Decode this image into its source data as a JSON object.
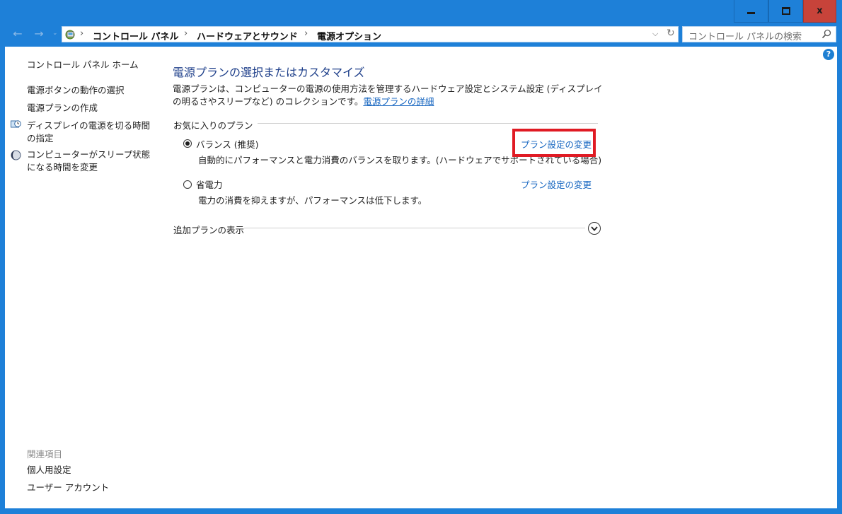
{
  "window": {
    "minimize_glyph": "minimize-icon",
    "maximize_glyph": "maximize-icon",
    "close_glyph": "x"
  },
  "nav": {
    "back_glyph": "←",
    "forward_glyph": "→",
    "recent_glyph": "⌄",
    "breadcrumb": [
      "コントロール パネル",
      "ハードウェアとサウンド",
      "電源オプション"
    ],
    "separator": "›",
    "dropdown_glyph": "⌵",
    "refresh_glyph": "↻",
    "search_placeholder": "コントロール パネルの検索"
  },
  "help": {
    "glyph": "?"
  },
  "sidebar": {
    "home": "コントロール パネル ホーム",
    "links": [
      "電源ボタンの動作の選択",
      "電源プランの作成",
      "ディスプレイの電源を切る時間の指定",
      "コンピューターがスリープ状態になる時間を変更"
    ],
    "related_heading": "関連項目",
    "related_links": [
      "個人用設定",
      "ユーザー アカウント"
    ]
  },
  "main": {
    "title": "電源プランの選択またはカスタマイズ",
    "description": "電源プランは、コンピューターの電源の使用方法を管理するハードウェア設定とシステム設定 (ディスプレイの明るさやスリープなど) のコレクションです。",
    "description_link": "電源プランの詳細",
    "favorites_label": "お気に入りのプラン",
    "plans": [
      {
        "name": "バランス (推奨)",
        "description": "自動的にパフォーマンスと電力消費のバランスを取ります。(ハードウェアでサポートされている場合)",
        "link": "プラン設定の変更",
        "selected": true
      },
      {
        "name": "省電力",
        "description": "電力の消費を抑えますが、パフォーマンスは低下します。",
        "link": "プラン設定の変更",
        "selected": false
      }
    ],
    "show_more_label": "追加プランの表示"
  },
  "colors": {
    "frame": "#1e80d8",
    "close": "#c7433a",
    "title": "#1e3f8a",
    "link": "#1565c0",
    "highlight": "#e01b24"
  }
}
